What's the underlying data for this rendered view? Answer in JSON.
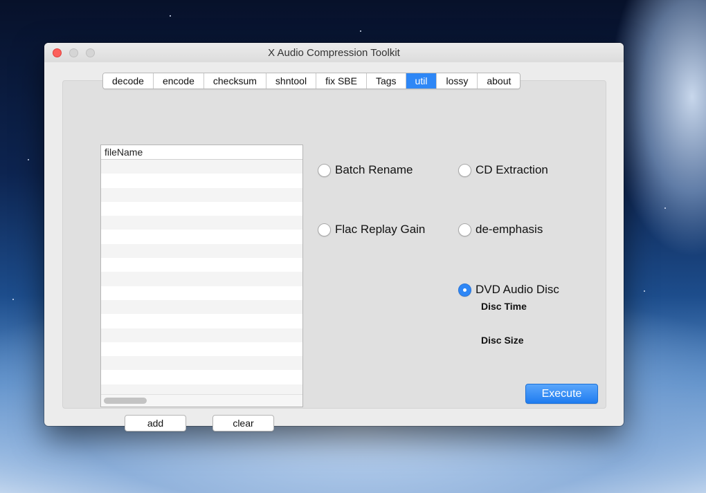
{
  "window": {
    "title": "X Audio Compression Toolkit"
  },
  "tabs": [
    {
      "label": "decode",
      "active": false
    },
    {
      "label": "encode",
      "active": false
    },
    {
      "label": "checksum",
      "active": false
    },
    {
      "label": "shntool",
      "active": false
    },
    {
      "label": "fix SBE",
      "active": false
    },
    {
      "label": "Tags",
      "active": false
    },
    {
      "label": "util",
      "active": true
    },
    {
      "label": "lossy",
      "active": false
    },
    {
      "label": "about",
      "active": false
    }
  ],
  "file_list": {
    "column_header": "fileName",
    "rows": []
  },
  "buttons": {
    "add": "add",
    "clear": "clear",
    "execute": "Execute"
  },
  "options": {
    "batch_rename": {
      "label": "Batch Rename",
      "checked": false
    },
    "cd_extraction": {
      "label": "CD Extraction",
      "checked": false
    },
    "flac_replay_gain": {
      "label": "Flac Replay Gain",
      "checked": false
    },
    "de_emphasis": {
      "label": "de-emphasis",
      "checked": false
    },
    "dvd_audio_disc": {
      "label": "DVD Audio Disc",
      "checked": true
    }
  },
  "dvd_info": {
    "disc_time_label": "Disc Time",
    "disc_size_label": "Disc Size"
  },
  "colors": {
    "accent": "#2e87f6",
    "close_button": "#fc605c"
  }
}
